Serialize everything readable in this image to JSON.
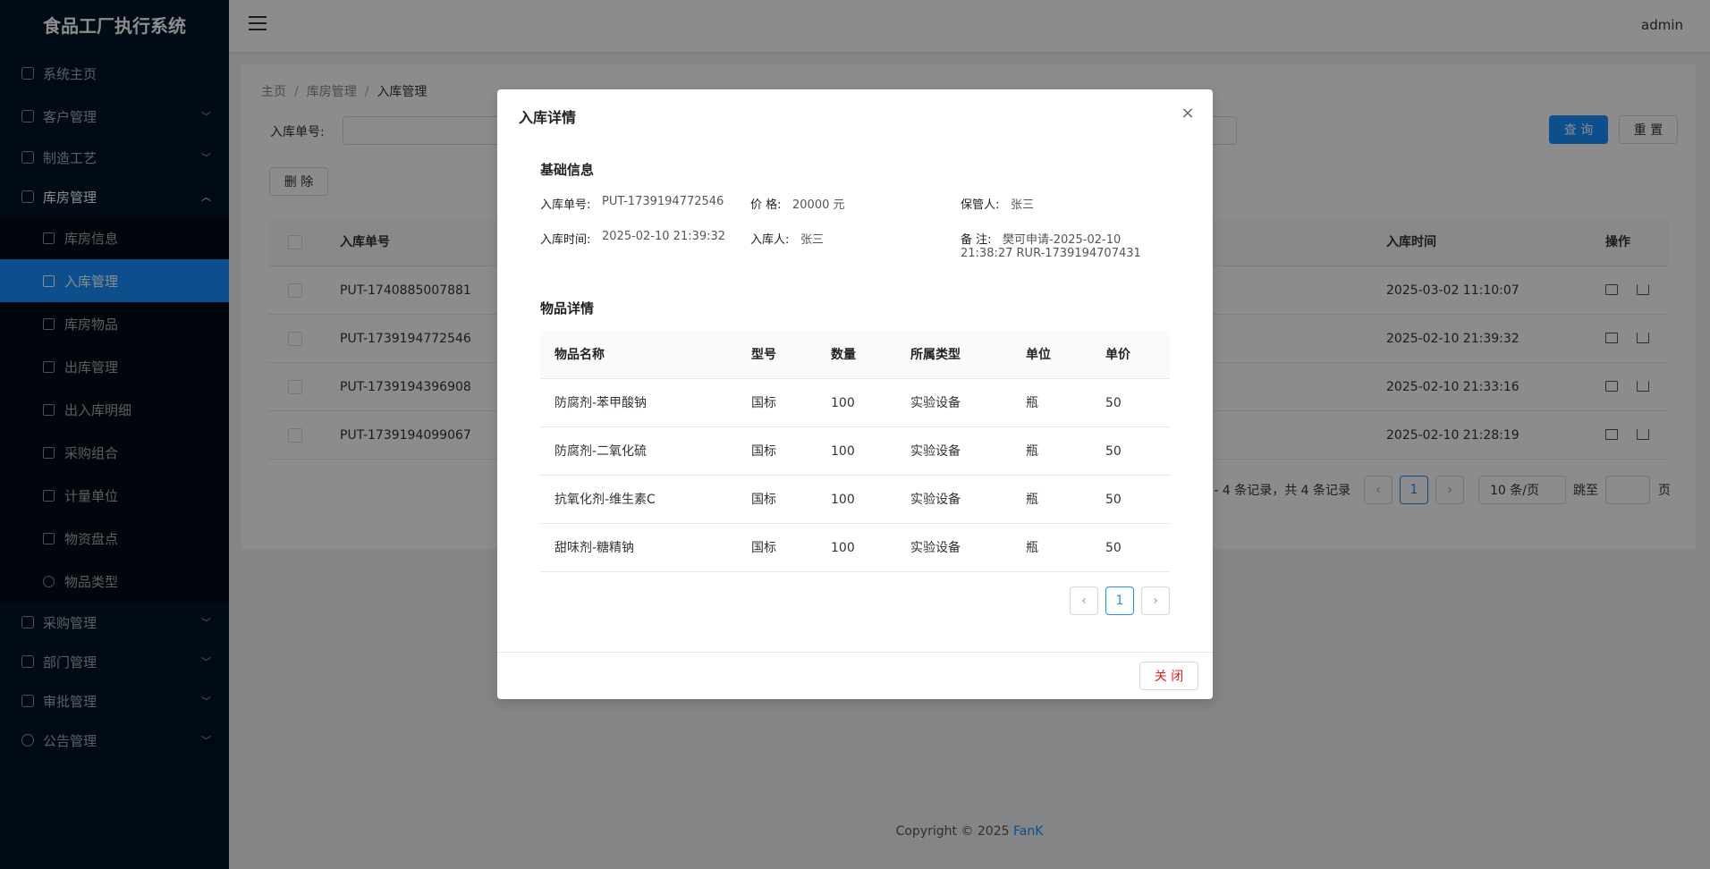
{
  "app": {
    "title": "食品工厂执行系统",
    "user": "admin"
  },
  "sidebar": {
    "items": [
      {
        "label": "系统主页",
        "icon": "home-icon"
      },
      {
        "label": "客户管理",
        "icon": "user-icon"
      },
      {
        "label": "制造工艺",
        "icon": "bulb-icon"
      },
      {
        "label": "库房管理",
        "icon": "inbox-icon"
      }
    ],
    "sub": [
      {
        "label": "库房信息",
        "icon": "idcard-icon"
      },
      {
        "label": "入库管理",
        "icon": "login-icon"
      },
      {
        "label": "库房物品",
        "icon": "table-icon"
      },
      {
        "label": "出库管理",
        "icon": "cluster-icon"
      },
      {
        "label": "出入库明细",
        "icon": "container-icon"
      },
      {
        "label": "采购组合",
        "icon": "profile-icon"
      },
      {
        "label": "计量单位",
        "icon": "barcode-icon"
      },
      {
        "label": "物资盘点",
        "icon": "audit-icon"
      },
      {
        "label": "物品类型",
        "icon": "loading-icon"
      }
    ],
    "bottom": [
      {
        "label": "采购管理",
        "icon": "reconciliation-icon"
      },
      {
        "label": "部门管理",
        "icon": "user-icon"
      },
      {
        "label": "审批管理",
        "icon": "border-icon"
      },
      {
        "label": "公告管理",
        "icon": "message-icon"
      }
    ]
  },
  "breadcrumb": {
    "home": "主页",
    "parent": "库房管理",
    "current": "入库管理",
    "sep": "/"
  },
  "search": {
    "label": "入库单号:",
    "query_label": "查 询",
    "reset_label": "重 置"
  },
  "toolbar": {
    "delete_label": "删 除"
  },
  "table": {
    "headers": {
      "code": "入库单号",
      "time": "入库时间",
      "ops": "操作"
    },
    "rows": [
      {
        "code": "PUT-1740885007881",
        "time": "2025-03-02 11:10:07"
      },
      {
        "code": "PUT-1739194772546",
        "time": "2025-02-10 21:39:32"
      },
      {
        "code": "PUT-1739194396908",
        "time": "2025-02-10 21:33:16"
      },
      {
        "code": "PUT-1739194099067",
        "time": "2025-02-10 21:28:19"
      }
    ]
  },
  "pager": {
    "summary": "1 - 4 条记录，共 4 条记录",
    "current": "1",
    "size": "10 条/页",
    "jump": "跳至",
    "page_unit": "页"
  },
  "footer": {
    "copyright": "Copyright © 2025",
    "author": "FanK"
  },
  "modal": {
    "title": "入库详情",
    "close_symbol": "×",
    "basic_title": "基础信息",
    "info": {
      "code_label": "入库单号:",
      "code": "PUT-1739194772546",
      "price_label": "价 格:",
      "price": "20000 元",
      "keeper_label": "保管人:",
      "keeper": "张三",
      "time_label": "入库时间:",
      "time": "2025-02-10 21:39:32",
      "person_label": "入库人:",
      "person": "张三",
      "remark_label": "备 注:",
      "remark_line1": "樊可申请-2025-02-10",
      "remark_line2": "21:38:27 RUR-1739194707431"
    },
    "goods_title": "物品详情",
    "goods_headers": {
      "name": "物品名称",
      "model": "型号",
      "qty": "数量",
      "type": "所属类型",
      "unit": "单位",
      "price": "单价"
    },
    "goods": [
      {
        "name": "防腐剂-苯甲酸钠",
        "model": "国标",
        "qty": "100",
        "type": "实验设备",
        "unit": "瓶",
        "price": "50"
      },
      {
        "name": "防腐剂-二氧化硫",
        "model": "国标",
        "qty": "100",
        "type": "实验设备",
        "unit": "瓶",
        "price": "50"
      },
      {
        "name": "抗氧化剂-维生素C",
        "model": "国标",
        "qty": "100",
        "type": "实验设备",
        "unit": "瓶",
        "price": "50"
      },
      {
        "name": "甜味剂-糖精钠",
        "model": "国标",
        "qty": "100",
        "type": "实验设备",
        "unit": "瓶",
        "price": "50"
      }
    ],
    "page": "1",
    "close_label": "关 闭"
  }
}
